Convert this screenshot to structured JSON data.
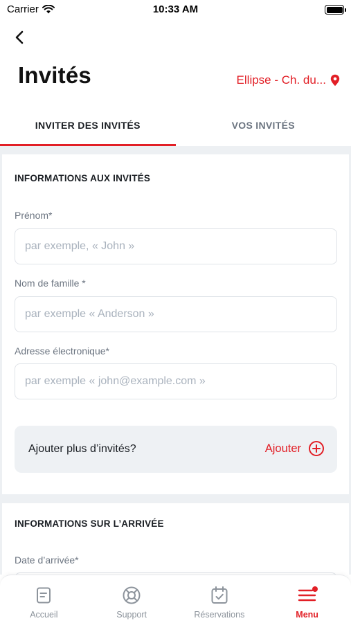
{
  "status_bar": {
    "carrier": "Carrier",
    "time": "10:33 AM"
  },
  "header": {
    "title": "Invités",
    "location": "Ellipse - Ch. du..."
  },
  "tabs": [
    {
      "label": "INVITER DES INVITÉS",
      "active": true
    },
    {
      "label": "VOS INVITÉS",
      "active": false
    }
  ],
  "guest_info": {
    "section_title": "INFORMATIONS AUX INVITÉS",
    "first_name": {
      "label": "Prénom*",
      "placeholder": "par exemple, « John »",
      "value": ""
    },
    "last_name": {
      "label": "Nom de famille *",
      "placeholder": "par exemple « Anderson »",
      "value": ""
    },
    "email": {
      "label": "Adresse électronique*",
      "placeholder": "par exemple « john@example.com »",
      "value": ""
    },
    "add_more": {
      "question": "Ajouter plus d’invités?",
      "action_label": "Ajouter"
    }
  },
  "arrival_info": {
    "section_title": "INFORMATIONS SUR L’ARRIVÉE",
    "arrival_date": {
      "label": "Date d’arrivée*"
    }
  },
  "bottom_nav": [
    {
      "label": "Accueil",
      "icon": "document-icon",
      "active": false
    },
    {
      "label": "Support",
      "icon": "lifebuoy-icon",
      "active": false
    },
    {
      "label": "Réservations",
      "icon": "calendar-check-icon",
      "active": false
    },
    {
      "label": "Menu",
      "icon": "menu-icon",
      "active": true
    }
  ],
  "colors": {
    "accent": "#e21f26",
    "background": "#edf0f3",
    "text": "#1b1f24",
    "muted": "#6b7480"
  }
}
